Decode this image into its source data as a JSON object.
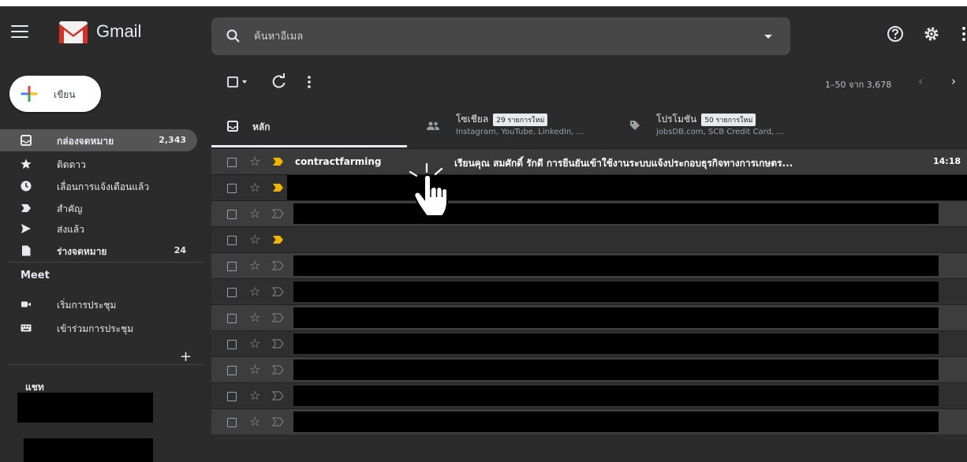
{
  "header": {
    "app_name": "Gmail",
    "search_placeholder": "ค้นหาอีเมล"
  },
  "compose": {
    "label": "เขียน"
  },
  "sidebar": {
    "items": [
      {
        "label": "กล่องจดหมาย",
        "count": "2,343",
        "active": true,
        "icon": "inbox-icon"
      },
      {
        "label": "ติดดาว",
        "count": "",
        "icon": "star-icon"
      },
      {
        "label": "เลื่อนการแจ้งเตือนแล้ว",
        "count": "",
        "icon": "clock-icon"
      },
      {
        "label": "สำคัญ",
        "count": "",
        "icon": "important-icon"
      },
      {
        "label": "ส่งแล้ว",
        "count": "",
        "icon": "send-icon"
      },
      {
        "label": "ร่างจดหมาย",
        "count": "24",
        "icon": "draft-icon"
      }
    ],
    "meet_title": "Meet",
    "meet_items": [
      {
        "label": "เริ่มการประชุม",
        "icon": "video-icon"
      },
      {
        "label": "เข้าร่วมการประชุม",
        "icon": "keyboard-icon"
      }
    ],
    "chat_title": "แชท",
    "chat_add": "+"
  },
  "toolbar": {
    "pager": "1–50 จาก 3,678",
    "prev": "‹",
    "next": "›"
  },
  "tabs": [
    {
      "label": "หลัก",
      "sub": "",
      "chip": "",
      "icon": "inbox-icon",
      "selected": true
    },
    {
      "label": "โซเชียล",
      "chip": "29 รายการใหม่",
      "sub": "Instagram, YouTube, LinkedIn, ...",
      "icon": "people-icon"
    },
    {
      "label": "โปรโมชัน",
      "chip": "50 รายการใหม่",
      "sub": "jobsDB.com, SCB Credit Card, ...",
      "icon": "tag-icon"
    }
  ],
  "emails": [
    {
      "sender": "contractfarming",
      "subject": "เรียนคุณ สมศักดิ์ รักดี การยืนยันเข้าใช้งานระบบแจ้งประกอบธุรกิจทางการเกษตร...",
      "time": "14:18",
      "important": true
    },
    {
      "important": true
    },
    {
      "important": false
    },
    {
      "important": true
    },
    {
      "important": false
    },
    {
      "important": false
    },
    {
      "important": false
    },
    {
      "important": false
    },
    {
      "important": false
    },
    {
      "important": false
    },
    {
      "important": false
    }
  ],
  "colors": {
    "background": "#2b2b2b",
    "search": "#474747",
    "important_marker": "#f2b400",
    "active_nav": "#555555"
  }
}
